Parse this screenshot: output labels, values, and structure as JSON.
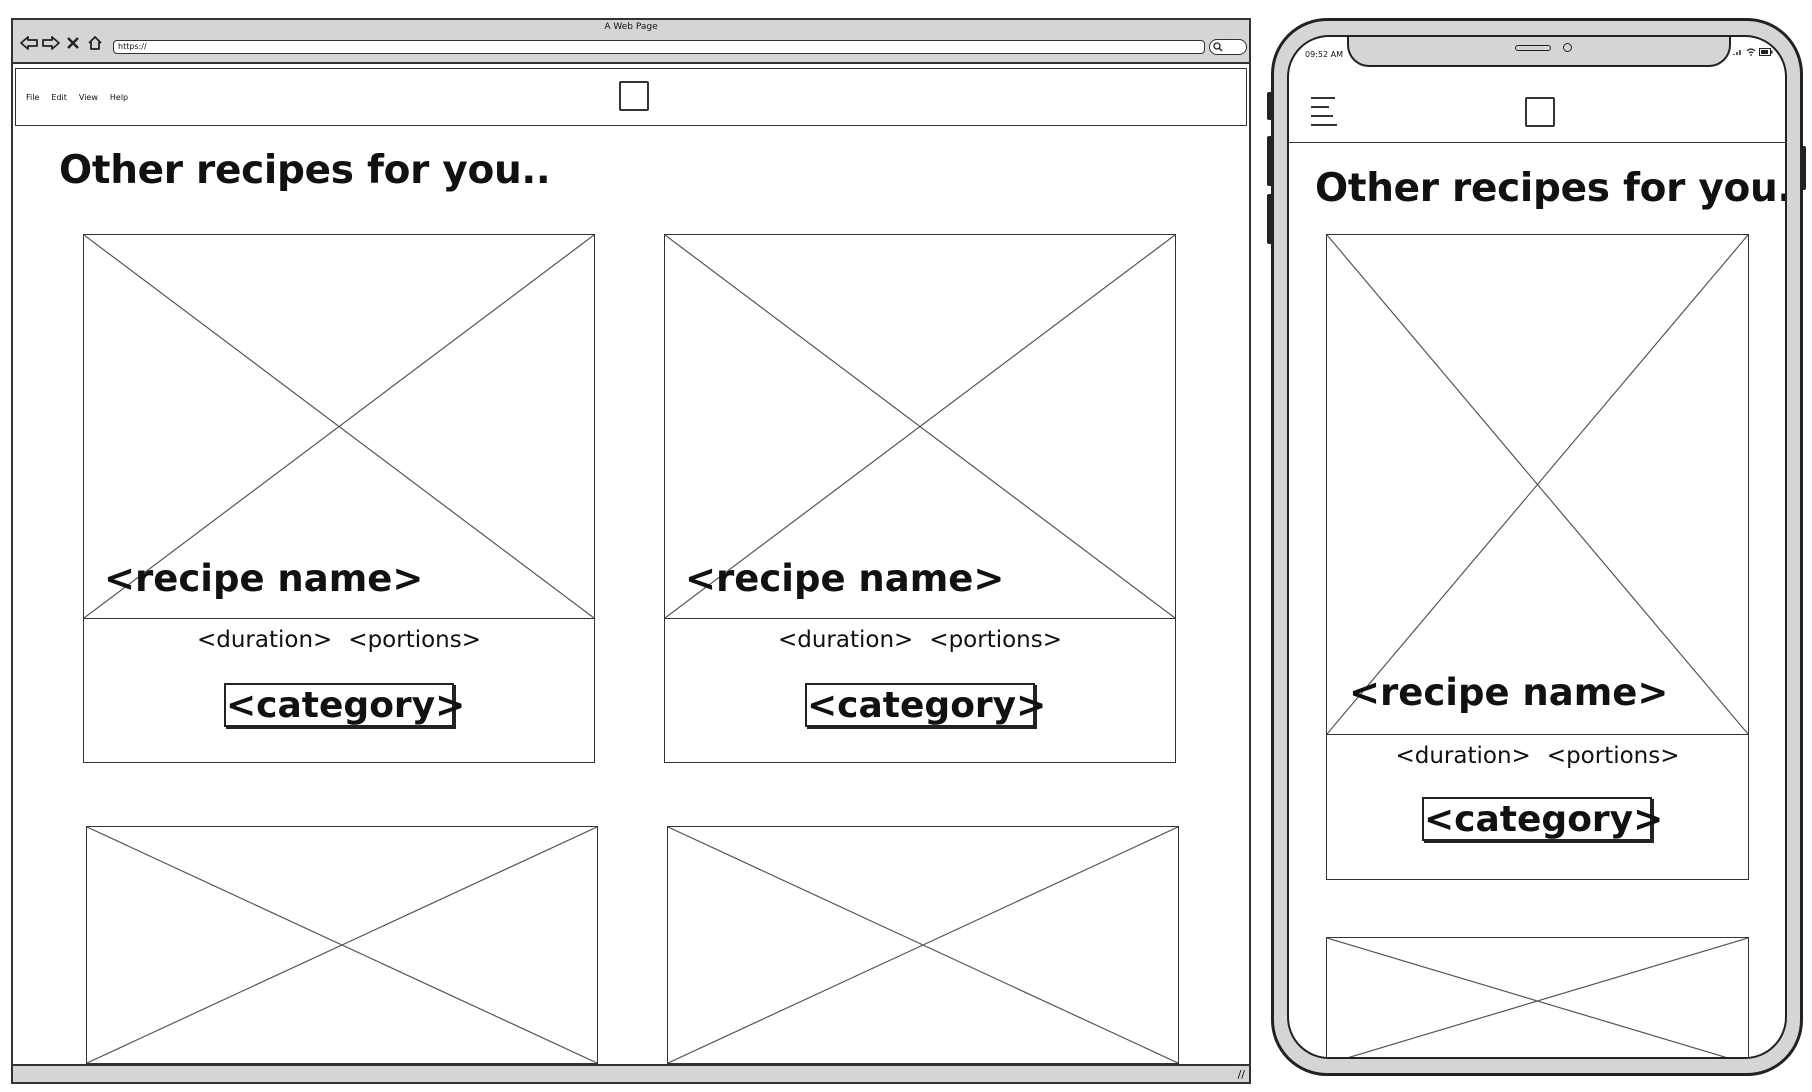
{
  "desktop": {
    "window_title": "A Web Page",
    "url": "https://",
    "menu": [
      "File",
      "Edit",
      "View",
      "Help"
    ],
    "heading": "Other recipes for you..",
    "cards": [
      {
        "recipe_name": "<recipe name>",
        "duration": "<duration>",
        "portions": "<portions>",
        "category": "<category>"
      },
      {
        "recipe_name": "<recipe name>",
        "duration": "<duration>",
        "portions": "<portions>",
        "category": "<category>"
      }
    ]
  },
  "mobile": {
    "time": "09:52 AM",
    "heading": "Other recipes for you..",
    "card": {
      "recipe_name": "<recipe name>",
      "duration": "<duration>",
      "portions": "<portions>",
      "category": "<category>"
    }
  }
}
